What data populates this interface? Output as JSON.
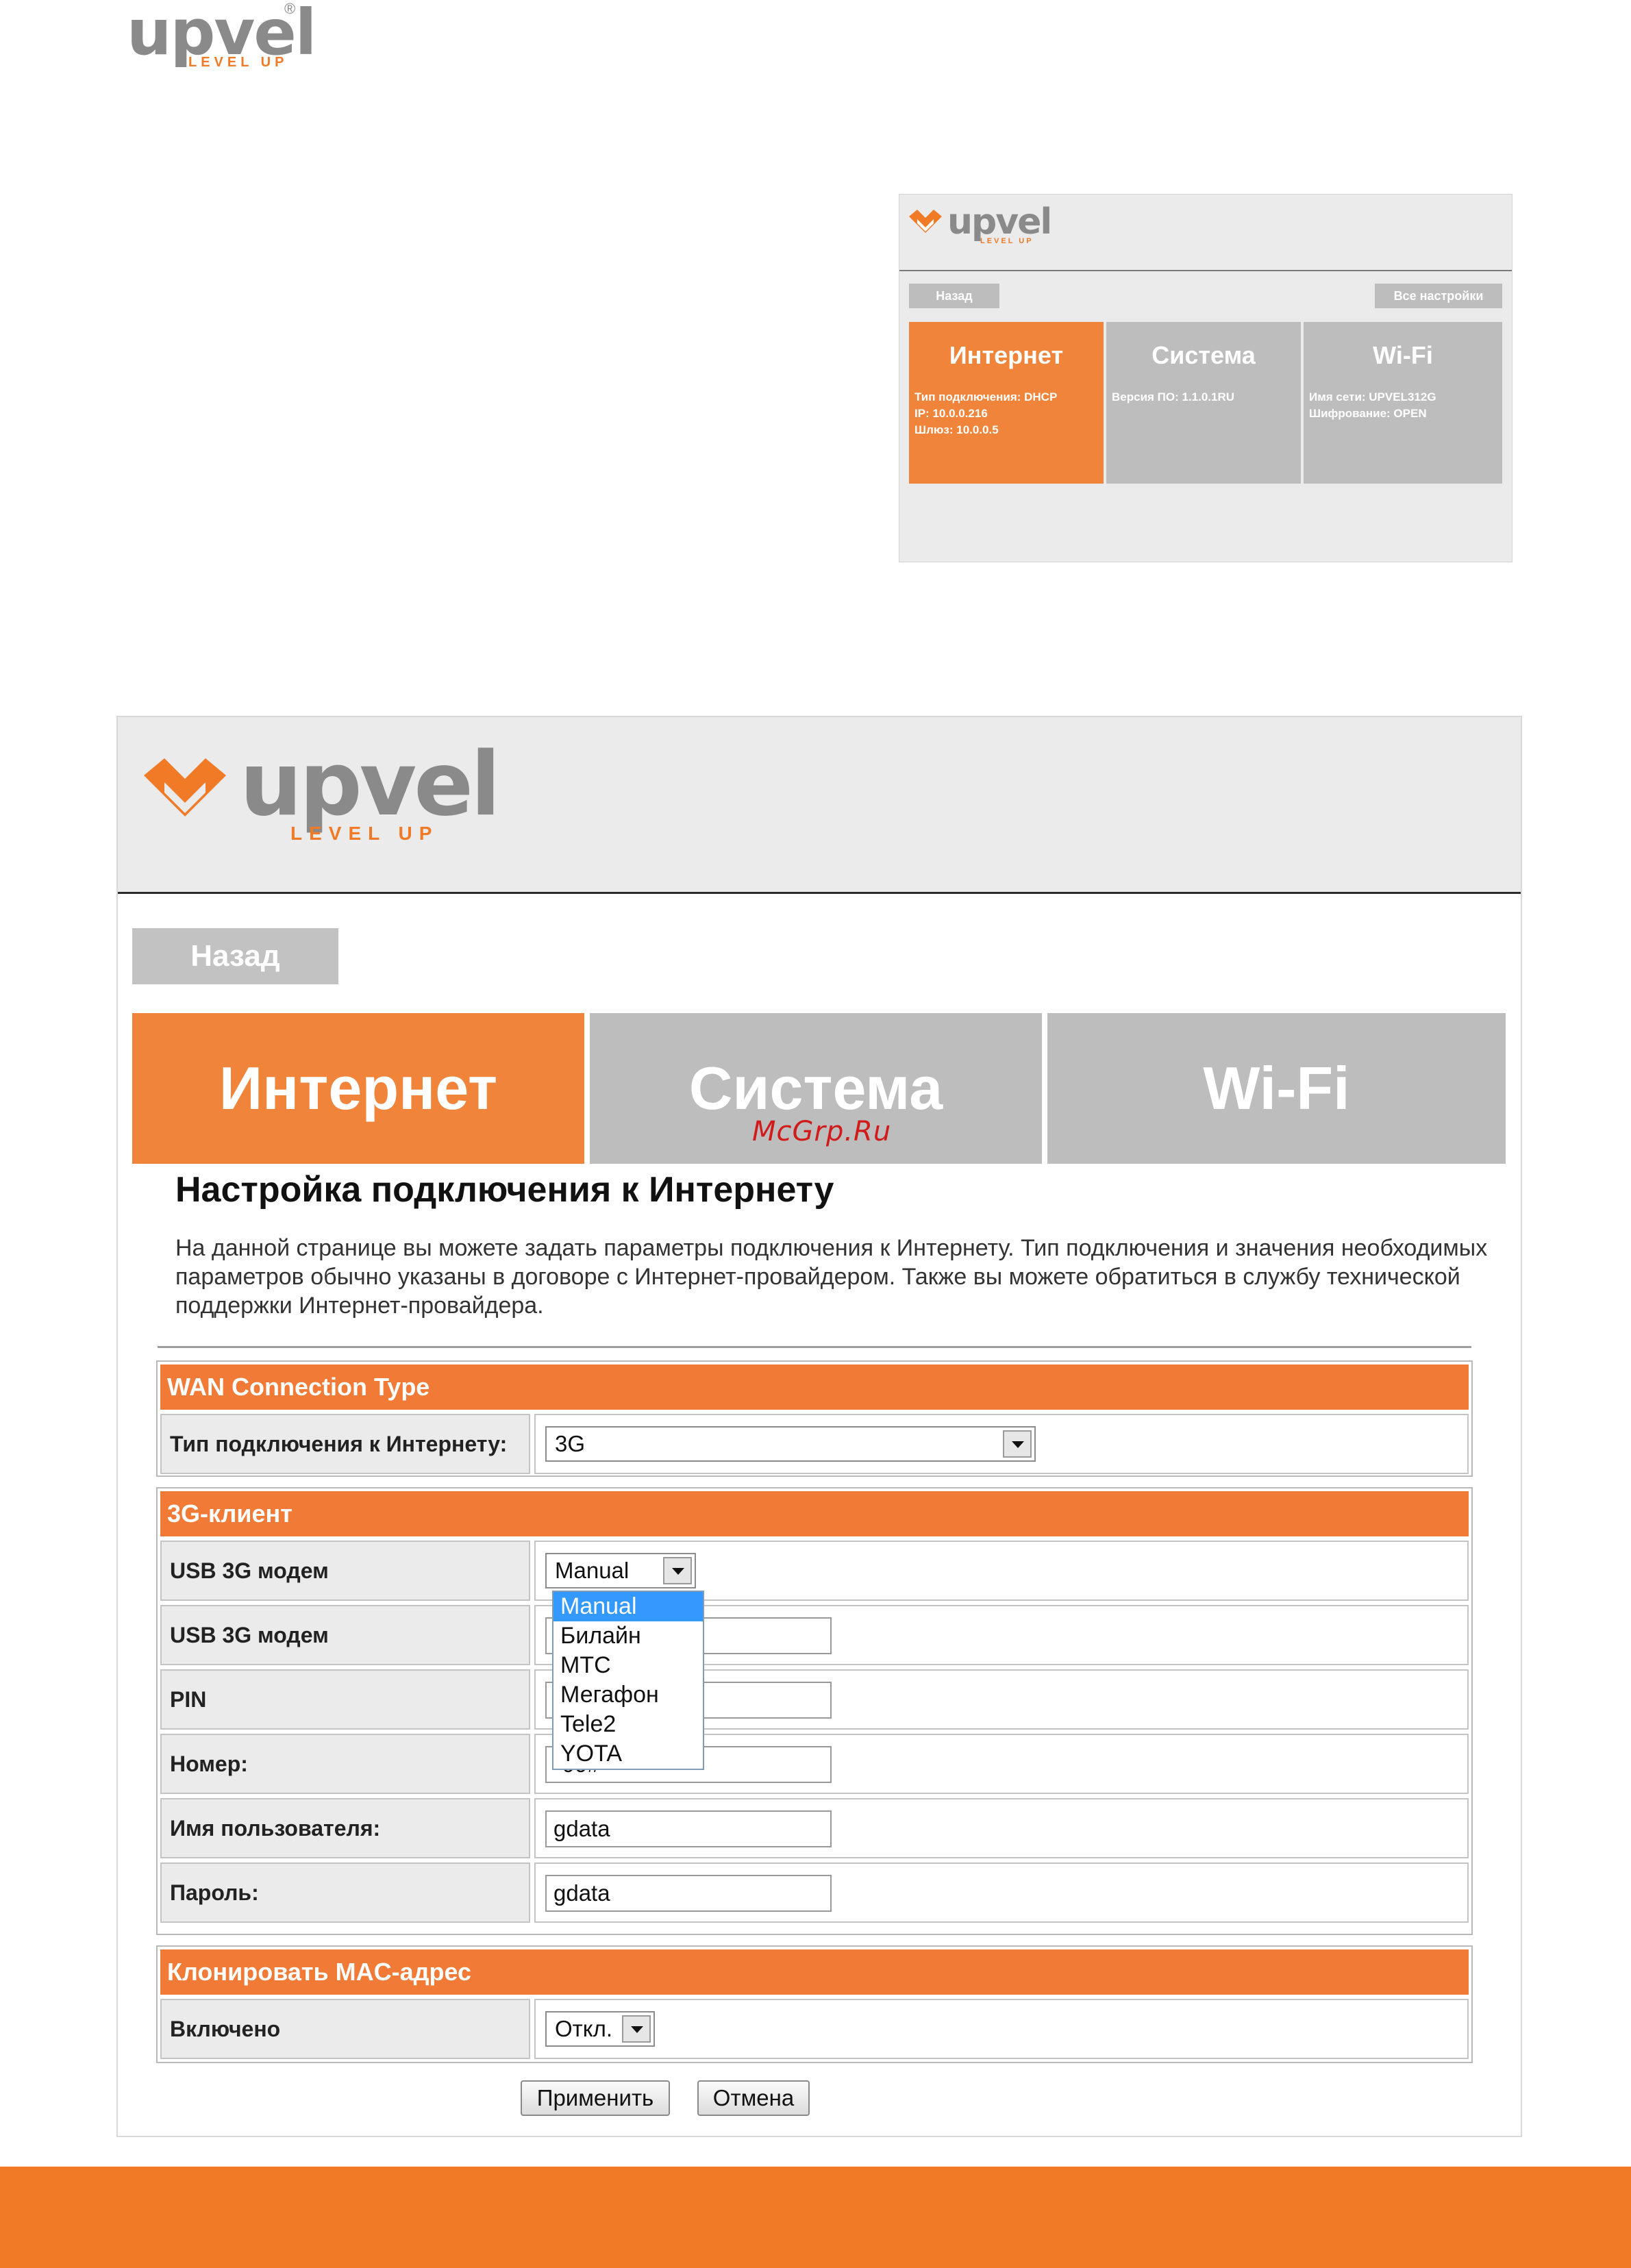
{
  "page_logo": {
    "word": "upvel",
    "tagline": "LEVEL UP",
    "reg": "®"
  },
  "small_shot": {
    "logo_word": "upvel",
    "logo_tagline": "LEVEL UP",
    "back_label": "Назад",
    "all_settings_label": "Все настройки",
    "tiles": [
      {
        "title": "Интернет",
        "lines": [
          "Тип подключения: DHCP",
          "IP: 10.0.0.216",
          "Шлюз: 10.0.0.5"
        ]
      },
      {
        "title": "Система",
        "lines": [
          "Версия ПО: 1.1.0.1RU"
        ]
      },
      {
        "title": "Wi-Fi",
        "lines": [
          "Имя сети: UPVEL312G",
          "Шифрование: OPEN"
        ]
      }
    ]
  },
  "big_shot": {
    "logo_word": "upvel",
    "logo_tagline": "LEVEL UP",
    "back_label": "Назад",
    "tabs": [
      "Интернет",
      "Система",
      "Wi-Fi"
    ],
    "watermark": "McGrp.Ru",
    "title": "Настройка подключения к Интернету",
    "description": "На данной странице вы можете задать параметры подключения к Интернету. Тип подключения и значения необходимых параметров обычно указаны в договоре с Интернет-провайдером. Также вы можете обратиться в службу технической поддержки Интернет-провайдера.",
    "wan": {
      "header": "WAN Connection Type",
      "type_label": "Тип подключения к Интернету:",
      "type_value": "3G"
    },
    "client3g": {
      "header": "3G-клиент",
      "modem_label": "USB 3G модем",
      "modem_value": "Manual",
      "modem2_label": "USB 3G модем",
      "pin_label": "PIN",
      "number_label": "Номер:",
      "number_partial": "*99#",
      "user_label": "Имя пользователя:",
      "user_value": "gdata",
      "pass_label": "Пароль:",
      "pass_value": "gdata",
      "dropdown_options": [
        "Manual",
        "Билайн",
        "МТС",
        "Мегафон",
        "Tele2",
        "YOTA"
      ]
    },
    "mac": {
      "header": "Клонировать MAC-адрес",
      "enabled_label": "Включено",
      "enabled_value": "Откл."
    },
    "apply_label": "Применить",
    "cancel_label": "Отмена"
  },
  "colors": {
    "accent": "#f07a26",
    "tile_orange": "#f0843a",
    "tile_gray": "#bdbdbd"
  }
}
